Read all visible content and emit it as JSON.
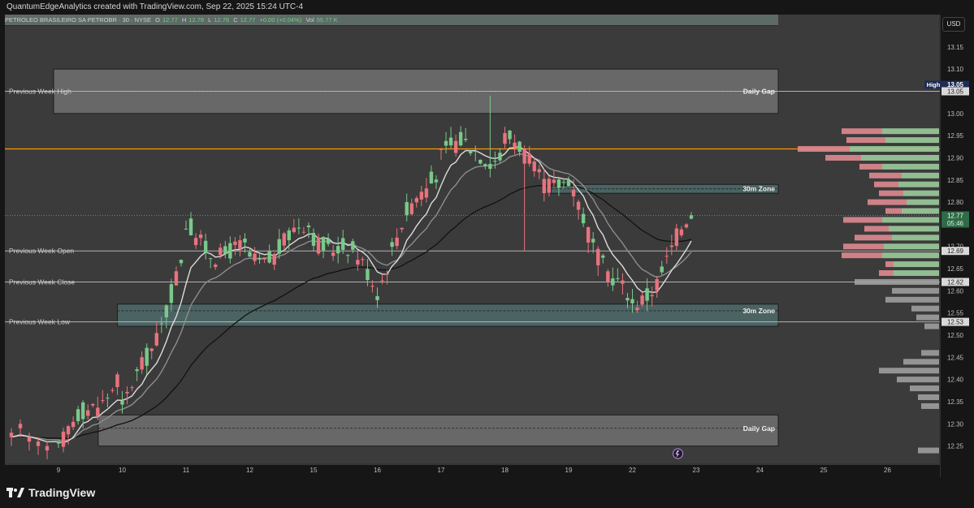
{
  "header": {
    "attribution": "QuantumEdgeAnalytics created with TradingView.com, Sep 22, 2025 15:24 UTC-4"
  },
  "symbol_bar": {
    "name": "PETROLEO BRASILEIRO SA PETROBR · 30 · NYSE",
    "o_label": "O",
    "o_value": "12.77",
    "h_label": "H",
    "h_value": "12.78",
    "l_label": "L",
    "l_value": "12.76",
    "c_label": "C",
    "c_value": "12.77",
    "change": "+0.00 (+0.04%)",
    "vol_label": "Vol",
    "vol_value": "55.77 K"
  },
  "currency_button": "USD",
  "footer": {
    "brand": "TradingView"
  },
  "colors": {
    "bull": "#79c98a",
    "bear": "#e8737d",
    "ema_slow": "#111111",
    "ema_mid": "#8d8d8d",
    "ema_fast": "#dcdcdc",
    "orange_line": "#ff9800",
    "zone_fill": "#4f6b6b",
    "gap_fill": "#6e6e6e",
    "vp_bull": "#9ccc9c",
    "vp_bear": "#e08a91",
    "vp_gray": "#a5a5a5"
  },
  "chart_data": {
    "type": "candlestick",
    "timeframe": "30",
    "x_ticks": [
      "9",
      "10",
      "11",
      "12",
      "15",
      "16",
      "17",
      "18",
      "19",
      "22",
      "23",
      "24",
      "25",
      "26"
    ],
    "y_ticks": [
      "13.15",
      "13.10",
      "13.05",
      "13.00",
      "12.95",
      "12.90",
      "12.85",
      "12.80",
      "12.75",
      "12.70",
      "12.65",
      "12.60",
      "12.55",
      "12.50",
      "12.45",
      "12.40",
      "12.35",
      "12.30",
      "12.25"
    ],
    "y_range": [
      12.22,
      13.19
    ],
    "price_tags": [
      {
        "label": "High",
        "value": "13.05"
      },
      {
        "value": "13.05"
      },
      {
        "value": "12.77",
        "countdown": "05:46"
      },
      {
        "value": "12.69"
      },
      {
        "value": "12.62"
      },
      {
        "value": "12.53"
      }
    ],
    "levels": [
      {
        "label": "Previous Week High",
        "price": 13.05
      },
      {
        "label": "Previous Week Open",
        "price": 12.69
      },
      {
        "label": "Previous Week Close",
        "price": 12.62
      },
      {
        "label": "Previous Week Low",
        "price": 12.53
      },
      {
        "label": "",
        "price": 12.92
      }
    ],
    "zones": [
      {
        "label": "Daily Gap",
        "top": 13.1,
        "bottom": 13.0,
        "start_day": 0,
        "mid": 13.05
      },
      {
        "label": "30m Zone",
        "top": 12.84,
        "bottom": 12.82,
        "start_day": 7.8,
        "mid": 12.83
      },
      {
        "label": "30m Zone",
        "top": 12.57,
        "bottom": 12.52,
        "start_day": 1.0,
        "mid": 12.555
      },
      {
        "label": "Daily Gap",
        "top": 12.32,
        "bottom": 12.25,
        "start_day": 0.7,
        "mid": 12.29
      }
    ],
    "day_keys": [
      {
        "day": "9",
        "open": 12.24,
        "close": 12.43
      },
      {
        "day": "10",
        "open": 12.31,
        "close": 12.69
      },
      {
        "day": "11",
        "open": 12.73,
        "close": 12.67
      },
      {
        "day": "12",
        "open": 12.67,
        "close": 12.74
      },
      {
        "day": "15",
        "open": 12.74,
        "close": 12.62
      },
      {
        "day": "16",
        "open": 12.62,
        "close": 12.91
      },
      {
        "day": "17",
        "open": 12.91,
        "close": 12.92
      },
      {
        "day": "18",
        "open": 12.93,
        "close": 12.83
      },
      {
        "day": "19",
        "open": 12.83,
        "close": 12.55
      },
      {
        "day": "22",
        "open": 12.56,
        "close": 12.77
      }
    ],
    "volume_profile": [
      {
        "price": 12.96,
        "bull": 70,
        "bear": 50
      },
      {
        "price": 12.94,
        "bull": 66,
        "bear": 48
      },
      {
        "price": 12.92,
        "bull": 110,
        "bear": 64
      },
      {
        "price": 12.9,
        "bull": 96,
        "bear": 44
      },
      {
        "price": 12.88,
        "bull": 70,
        "bear": 28
      },
      {
        "price": 12.86,
        "bull": 46,
        "bear": 40
      },
      {
        "price": 12.84,
        "bull": 50,
        "bear": 30
      },
      {
        "price": 12.82,
        "bull": 44,
        "bear": 30
      },
      {
        "price": 12.8,
        "bull": 40,
        "bear": 48
      },
      {
        "price": 12.78,
        "bull": 46,
        "bear": 20
      },
      {
        "price": 12.76,
        "bull": 70,
        "bear": 48
      },
      {
        "price": 12.74,
        "bull": 62,
        "bear": 30
      },
      {
        "price": 12.72,
        "bull": 58,
        "bear": 46
      },
      {
        "price": 12.7,
        "bull": 68,
        "bear": 50
      },
      {
        "price": 12.68,
        "bull": 70,
        "bear": 50
      },
      {
        "price": 12.66,
        "bull": 56,
        "bear": 10
      },
      {
        "price": 12.64,
        "bull": 56,
        "bear": 18
      },
      {
        "price": 12.62,
        "gray": 104
      },
      {
        "price": 12.6,
        "gray": 58
      },
      {
        "price": 12.58,
        "gray": 66
      },
      {
        "price": 12.56,
        "gray": 34
      },
      {
        "price": 12.54,
        "gray": 28
      },
      {
        "price": 12.52,
        "gray": 18
      },
      {
        "price": 12.46,
        "gray": 22
      },
      {
        "price": 12.44,
        "gray": 44
      },
      {
        "price": 12.42,
        "gray": 74
      },
      {
        "price": 12.4,
        "gray": 52
      },
      {
        "price": 12.38,
        "gray": 36
      },
      {
        "price": 12.36,
        "gray": 26
      },
      {
        "price": 12.34,
        "gray": 22
      },
      {
        "price": 12.24,
        "gray": 26
      }
    ]
  }
}
